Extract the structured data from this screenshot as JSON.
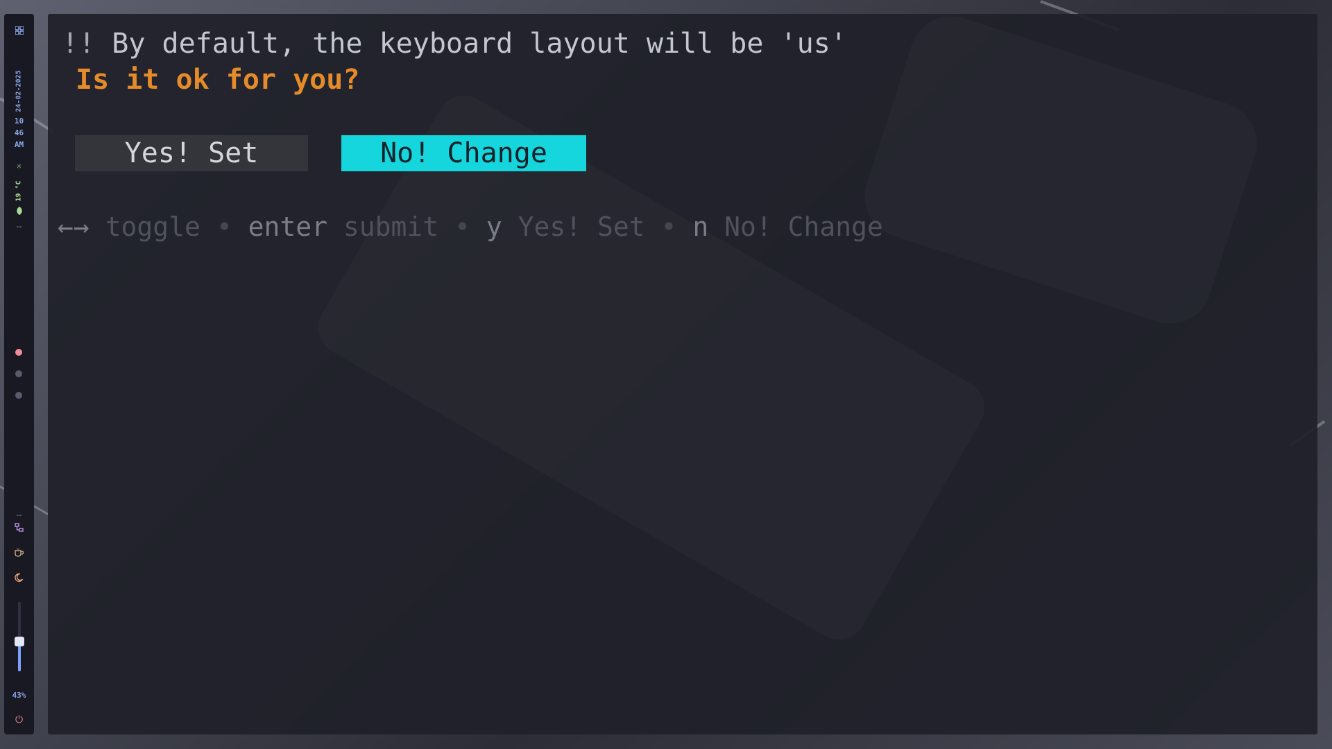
{
  "sidebar": {
    "date": "24-02-2025",
    "time": {
      "hour": "10",
      "minute": "46",
      "period": "AM"
    },
    "weather": {
      "icon": "sun-icon",
      "temperature": "19 °C"
    },
    "workspaces": [
      {
        "active": true
      },
      {
        "active": false
      },
      {
        "active": false
      }
    ],
    "volume": {
      "level": 0.43,
      "label": "43%"
    },
    "colors": {
      "active_workspace": "#f28b9a",
      "accent": "#8aa6e6",
      "green": "#a6da95"
    }
  },
  "terminal": {
    "warning_prefix": "!!",
    "warning_text": " By default, the keyboard layout will be 'us'",
    "question": "Is it ok for you?",
    "buttons": {
      "yes_label": "Yes! Set",
      "no_label": "No! Change",
      "selected": "no"
    },
    "help": {
      "toggle_key": "←→",
      "toggle_desc": "toggle",
      "submit_key": "enter",
      "submit_desc": "submit",
      "yes_key": "y",
      "yes_desc": "Yes! Set",
      "no_key": "n",
      "no_desc": "No! Change",
      "separator": "•"
    },
    "colors": {
      "question": "#e58b2a",
      "selected_button": "#14d6dc"
    }
  }
}
